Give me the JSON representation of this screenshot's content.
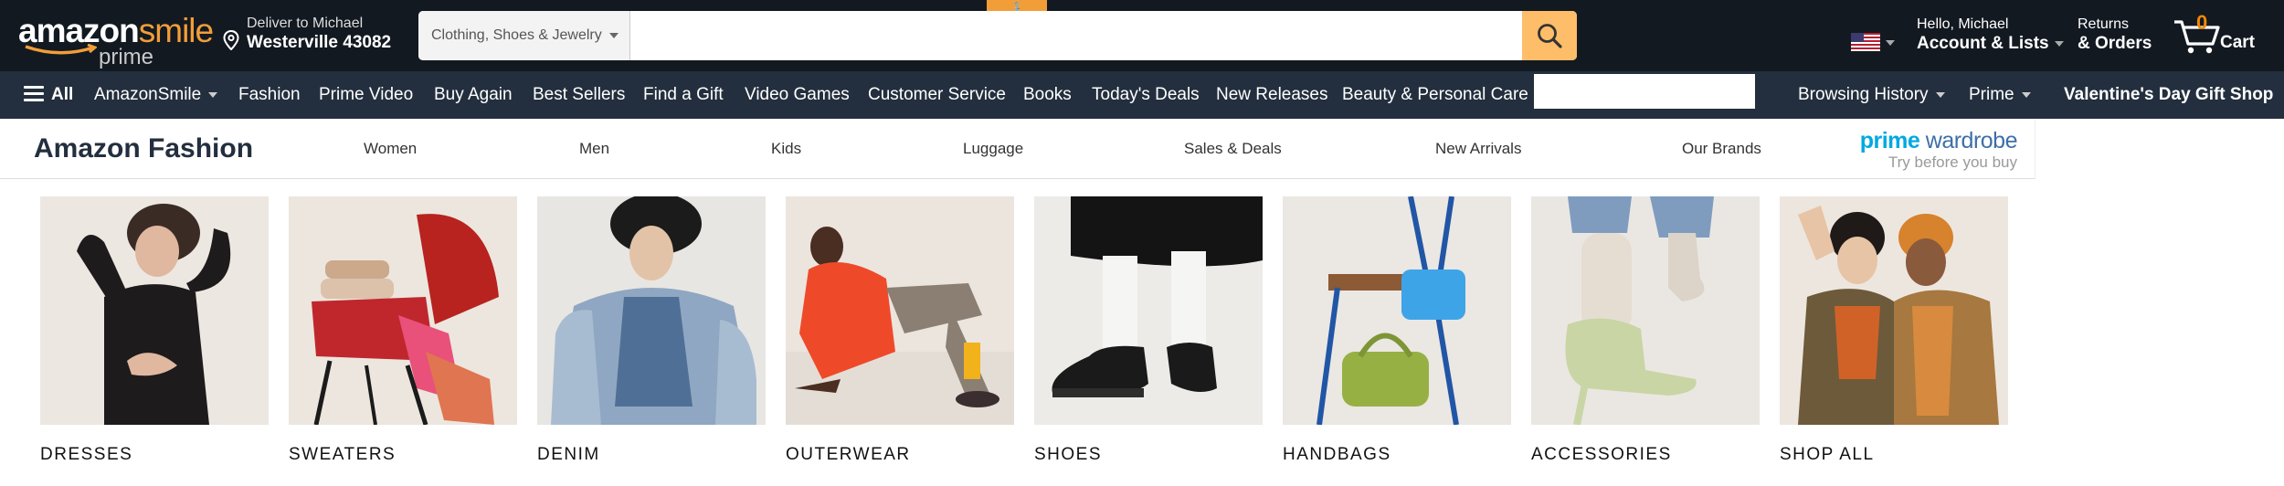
{
  "header": {
    "logo_text": "amazon",
    "logo_smile": "smile",
    "logo_prime": "prime",
    "deliver_line1": "Deliver to Michael",
    "deliver_line2": "Westerville 43082",
    "search": {
      "category": "Clothing, Shoes & Jewelry",
      "value": "",
      "placeholder": ""
    },
    "account_line1": "Hello, Michael",
    "account_line2": "Account & Lists",
    "returns_line1": "Returns",
    "returns_line2": "& Orders",
    "cart_count": "0",
    "cart_label": "Cart"
  },
  "nav": {
    "all_label": "All",
    "items": [
      "AmazonSmile",
      "Fashion",
      "Prime Video",
      "Buy Again",
      "Best Sellers",
      "Find a Gift",
      "Video Games",
      "Customer Service",
      "Books",
      "Today's Deals",
      "New Releases",
      "Beauty & Personal Care"
    ],
    "browsing_history": "Browsing History",
    "prime": "Prime",
    "promo": "Valentine's Day Gift Shop"
  },
  "fashion": {
    "title": "Amazon Fashion",
    "links": [
      "Women",
      "Men",
      "Kids",
      "Luggage",
      "Sales & Deals",
      "New Arrivals",
      "Our Brands"
    ],
    "prime_wardrobe_prime": "prime",
    "prime_wardrobe_word": "wardrobe",
    "prime_wardrobe_tagline": "Try before you buy"
  },
  "categories": [
    "DRESSES",
    "SWEATERS",
    "DENIM",
    "OUTERWEAR",
    "SHOES",
    "HANDBAGS",
    "ACCESSORIES",
    "SHOP ALL"
  ],
  "colors": {
    "header_bg": "#131921",
    "nav_bg": "#232f3e",
    "search_button": "#febd69",
    "accent_orange": "#f29e38",
    "cart_count": "#f08804"
  }
}
